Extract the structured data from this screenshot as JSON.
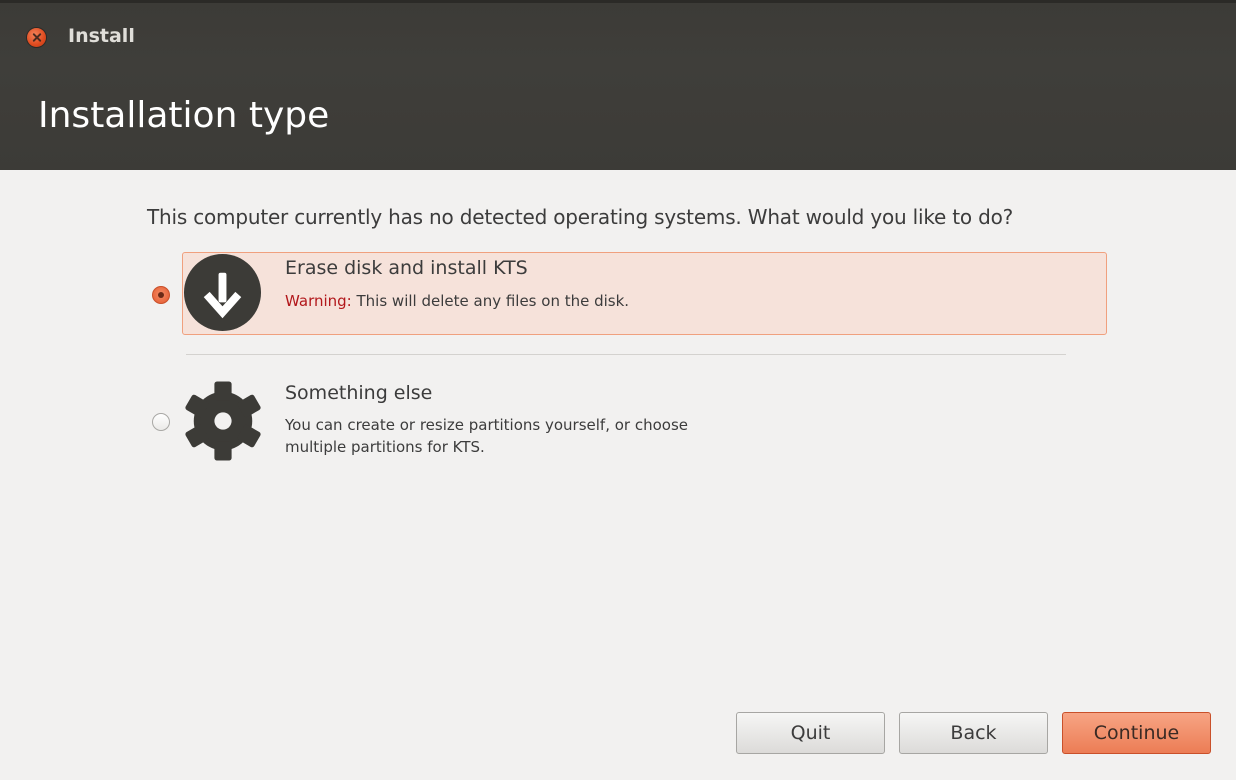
{
  "window": {
    "title": "Install",
    "page_title": "Installation type"
  },
  "question": "This computer currently has no detected operating systems. What would you like to do?",
  "options": [
    {
      "title": "Erase disk and install KTS",
      "warning_label": "Warning:",
      "description": "This will delete any files on the disk.",
      "selected": true,
      "icon": "download-arrow-icon"
    },
    {
      "title": "Something else",
      "description_line1": "You can create or resize partitions yourself, or choose",
      "description_line2": "multiple partitions for KTS.",
      "selected": false,
      "icon": "gear-icon"
    }
  ],
  "buttons": {
    "quit": "Quit",
    "back": "Back",
    "continue": "Continue"
  },
  "colors": {
    "accent": "#ec7d55",
    "warning": "#b2171b",
    "titlebar": "#3c3b37"
  }
}
